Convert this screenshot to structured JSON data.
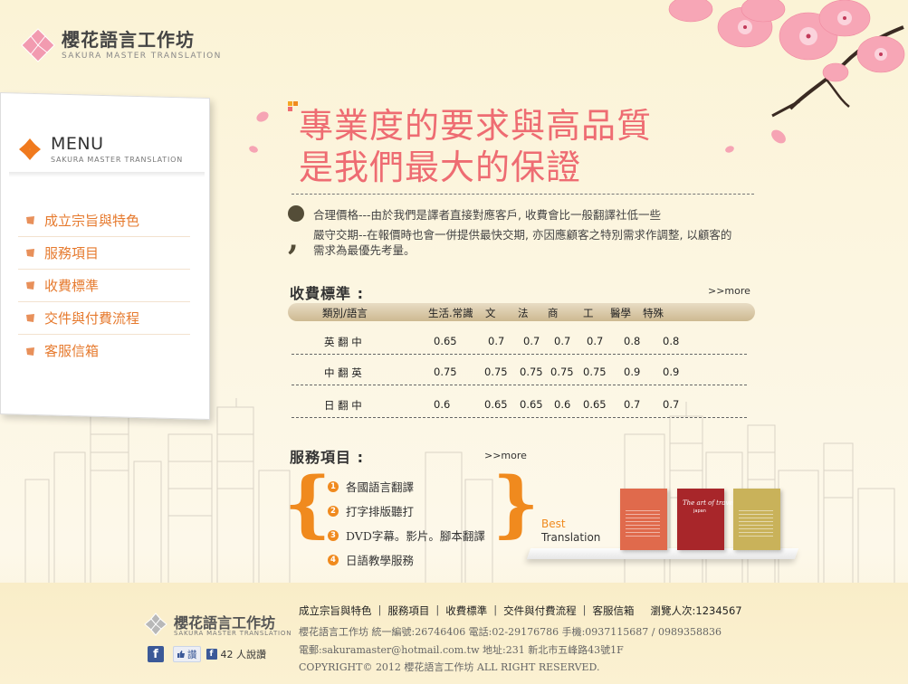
{
  "logo": {
    "name": "櫻花語言工作坊",
    "sub": "SAKURA MASTER TRANSLATION"
  },
  "menu": {
    "title": "MENU",
    "sub": "SAKURA MASTER TRANSLATION",
    "items": [
      {
        "label": "成立宗旨與特色"
      },
      {
        "label": "服務項目"
      },
      {
        "label": "收費標準"
      },
      {
        "label": "交件與付費流程"
      },
      {
        "label": "客服信箱"
      }
    ]
  },
  "headline": {
    "line1": "專業度的要求與高品質",
    "line2": "是我們最大的保證"
  },
  "intro": {
    "p1": "合理價格---由於我們是譯者直接對應客戶, 收費會比一般翻譯社低一些",
    "p2": "嚴守交期--在報價時也會一併提供最快交期, 亦因應顧客之特別需求作調整, 以顧客的需求為最優先考量。"
  },
  "pricing": {
    "title": "收費標準 :",
    "more": ">>more",
    "headers": [
      "類別/語言",
      "生活.常識",
      "文",
      "法",
      "商",
      "工",
      "醫學",
      "特殊"
    ],
    "rows": [
      [
        "英 翻 中",
        "0.65",
        "0.7",
        "0.7",
        "0.7",
        "0.7",
        "0.8",
        "0.8"
      ],
      [
        "中 翻 英",
        "0.75",
        "0.75",
        "0.75",
        "0.75",
        "0.75",
        "0.9",
        "0.9"
      ],
      [
        "日 翻 中",
        "0.6",
        "0.65",
        "0.65",
        "0.6",
        "0.65",
        "0.7",
        "0.7"
      ]
    ]
  },
  "services": {
    "title": "服務項目 :",
    "more": ">>more",
    "items": [
      {
        "num": "1",
        "label": "各國語言翻譯"
      },
      {
        "num": "2",
        "label": "打字排版聽打"
      },
      {
        "num": "3",
        "label": "DVD字幕。影片。腳本翻譯"
      },
      {
        "num": "4",
        "label": "日語教學服務"
      }
    ],
    "best_line1": "Best",
    "best_line2": "Translation",
    "book2_title": "The art of travel",
    "book2_sub": "japan"
  },
  "footer": {
    "logo_name": "櫻花語言工作坊",
    "logo_sub": "SAKURA MASTER TRANSLATION",
    "fb_letter": "f",
    "like_label": "讚",
    "like_count": "42 人說讚",
    "nav": [
      {
        "label": "成立宗旨與特色"
      },
      {
        "label": "服務項目"
      },
      {
        "label": "收費標準"
      },
      {
        "label": "交件與付費流程"
      },
      {
        "label": "客服信箱"
      }
    ],
    "nav_sep": "|",
    "visits": "瀏覽人次:1234567",
    "info1": "櫻花語言工作坊  統一編號:26746406  電話:02-29176786  手機:0937115687 / 0989358836",
    "info2": "電郵:sakuramaster@hotmail.com.tw  地址:231 新北市五峰路43號1F",
    "copyright": "COPYRIGHT© 2012 櫻花語言工作坊  ALL RIGHT RESERVED."
  },
  "colors": {
    "accent_pink": "#ee6c72",
    "accent_orange": "#f08a1e",
    "menu_text": "#e67a2e",
    "background": "#fbf3d6"
  }
}
